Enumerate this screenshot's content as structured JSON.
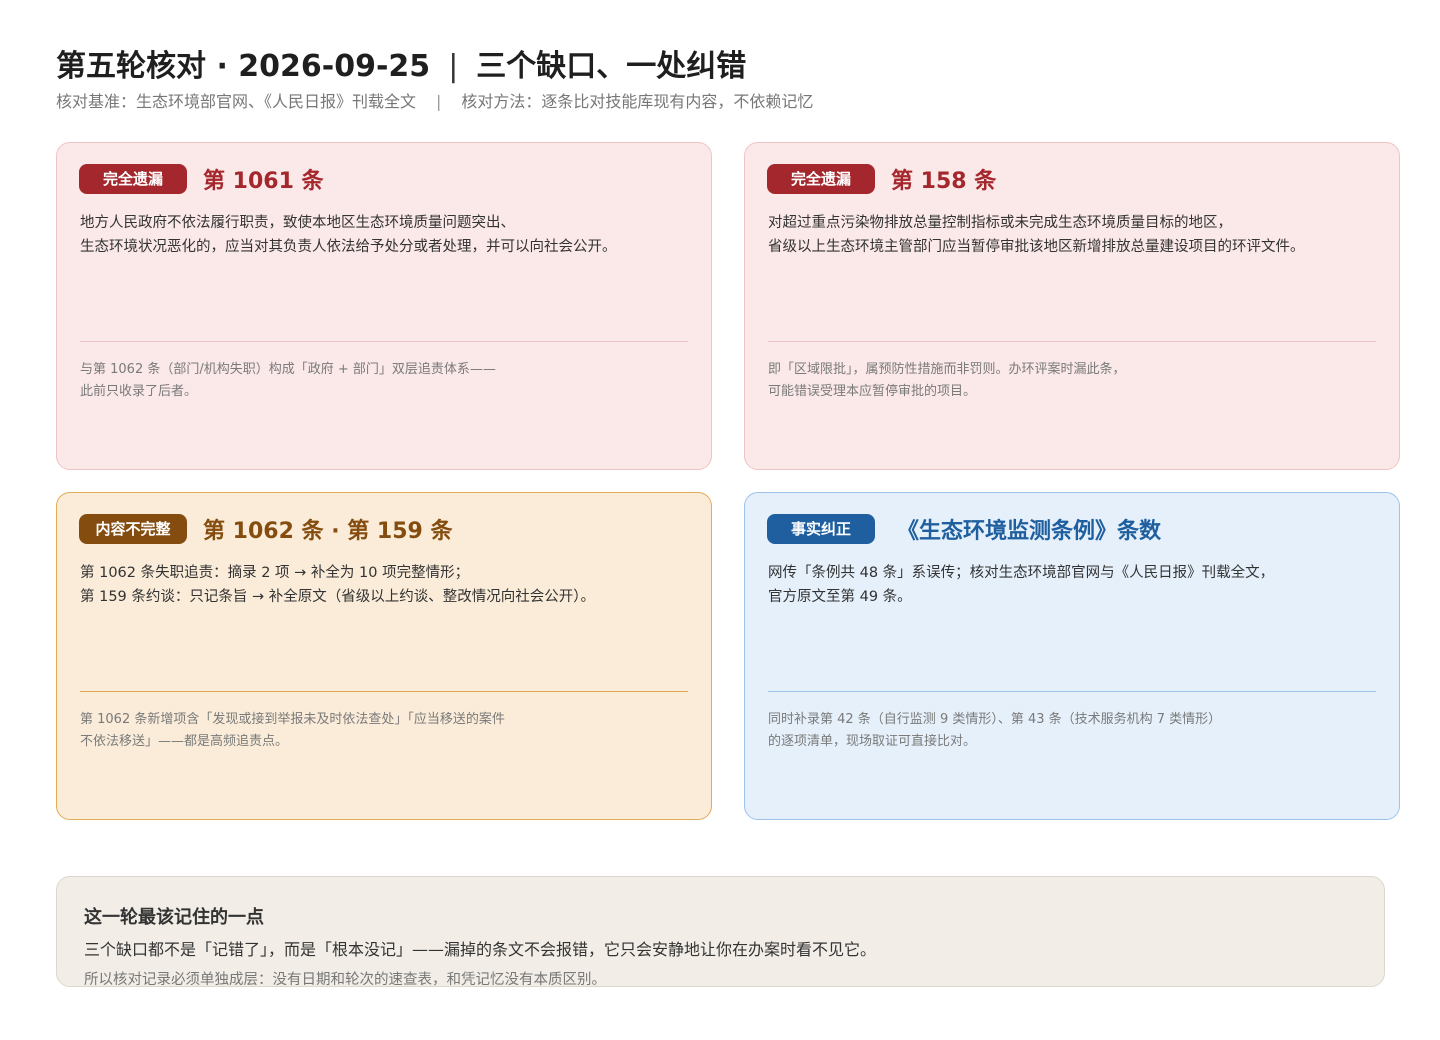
{
  "header": {
    "title": "第五轮核对 · 2026-09-25",
    "title_sep": "|",
    "title_tail": "三个缺口、一处纠错",
    "basis": "核对基准：生态环境部官网、《人民日报》刊载全文",
    "sub_sep": "|",
    "method": "核对方法：逐条比对技能库现有内容，不依赖记忆"
  },
  "cards": [
    {
      "badge": "完全遗漏",
      "title": "第 1061 条",
      "body": [
        "地方人民政府不依法履行职责，致使本地区生态环境质量问题突出、",
        "生态环境状况恶化的，应当对其负责人依法给予处分或者处理，并可以向社会公开。"
      ],
      "note": [
        "与第 1062 条（部门/机构失职）构成「政府 + 部门」双层追责体系——",
        "此前只收录了后者。"
      ]
    },
    {
      "badge": "完全遗漏",
      "title": "第 158 条",
      "body": [
        "对超过重点污染物排放总量控制指标或未完成生态环境质量目标的地区，",
        "省级以上生态环境主管部门应当暂停审批该地区新增排放总量建设项目的环评文件。"
      ],
      "note": [
        "即「区域限批」，属预防性措施而非罚则。办环评案时漏此条，",
        "可能错误受理本应暂停审批的项目。"
      ]
    },
    {
      "badge": "内容不完整",
      "title": "第 1062 条 · 第 159 条",
      "body": [
        "第 1062 条失职追责：摘录 2 项 → 补全为 10 项完整情形；",
        "第 159 条约谈：只记条旨 → 补全原文（省级以上约谈、整改情况向社会公开）。"
      ],
      "note": [
        "第 1062 条新增项含「发现或接到举报未及时依法查处」「应当移送的案件",
        "不依法移送」——都是高频追责点。"
      ]
    },
    {
      "badge": "事实纠正",
      "title": "《生态环境监测条例》条数",
      "body": [
        "网传「条例共 48 条」系误传；核对生态环境部官网与《人民日报》刊载全文，",
        "官方原文至第 49 条。"
      ],
      "note": [
        "同时补录第 42 条（自行监测 9 类情形）、第 43 条（技术服务机构 7 类情形）",
        "的逐项清单，现场取证可直接比对。"
      ]
    }
  ],
  "summary": {
    "title": "这一轮最该记住的一点",
    "main": "三个缺口都不是「记错了」，而是「根本没记」——漏掉的条文不会报错，它只会安静地让你在办案时看不见它。",
    "sub": "所以核对记录必须单独成层：没有日期和轮次的速查表，和凭记忆没有本质区别。"
  },
  "colors": {
    "red": "#a3272c",
    "amber": "#844d0f",
    "blue": "#1f5f9f"
  }
}
